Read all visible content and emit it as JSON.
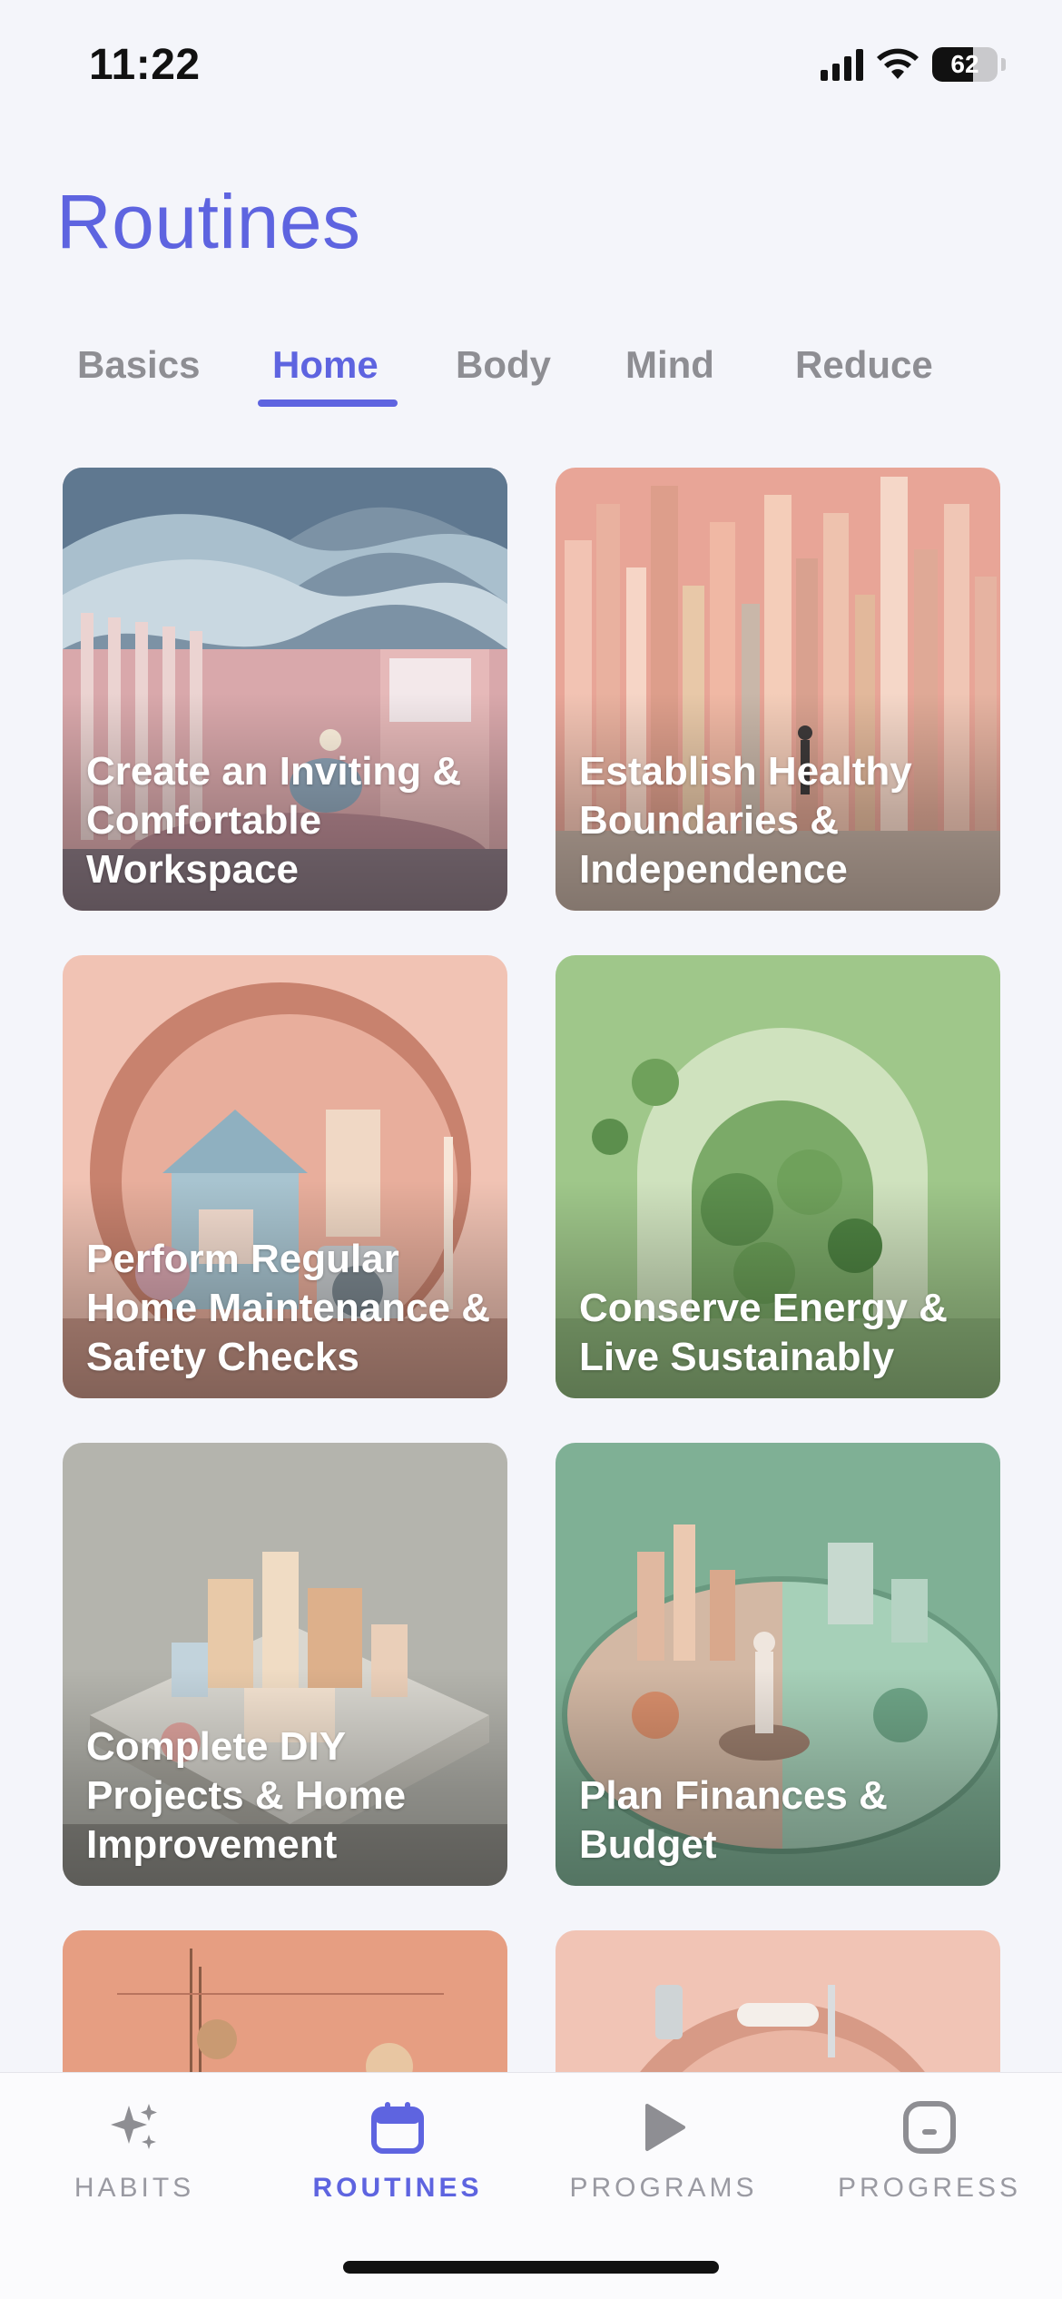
{
  "status_bar": {
    "time": "11:22",
    "battery": "62",
    "battery_level": 0.62
  },
  "page": {
    "title": "Routines"
  },
  "tabs": [
    {
      "label": "Basics",
      "active": false
    },
    {
      "label": "Home",
      "active": true
    },
    {
      "label": "Body",
      "active": false
    },
    {
      "label": "Mind",
      "active": false
    },
    {
      "label": "Reduce",
      "active": false
    }
  ],
  "routines": [
    {
      "title": "Create an Inviting & Comfortable Workspace",
      "image": "pastel-room-wave-ceiling",
      "colors": [
        "#7F93A6",
        "#D9AEB0",
        "#E8C4C2"
      ]
    },
    {
      "title": "Establish Healthy Boundaries & Independence",
      "image": "pastel-vertical-pillars-figure",
      "colors": [
        "#E5A89A",
        "#F2D2C3",
        "#C7B6A6"
      ]
    },
    {
      "title": "Perform Regular Home Maintenance & Safety Checks",
      "image": "house-tools-circle",
      "colors": [
        "#F0BFB0",
        "#C98572",
        "#9EB6C1"
      ]
    },
    {
      "title": "Conserve Energy & Live Sustainably",
      "image": "green-arch-plants",
      "colors": [
        "#A8CC8C",
        "#7FAF68",
        "#DDE9C9"
      ]
    },
    {
      "title": "Complete DIY Projects & Home Improvement",
      "image": "isometric-house-build",
      "colors": [
        "#B9B9B2",
        "#E2C7A8",
        "#8C8C86"
      ]
    },
    {
      "title": "Plan Finances & Budget",
      "image": "mint-plate-city-figure",
      "colors": [
        "#7DAF93",
        "#C7AE9A",
        "#A9D1BA"
      ]
    },
    {
      "title": "",
      "image": "peach-mobile-hanging",
      "colors": [
        "#E39B7F",
        "#F2C2A8",
        "#D38C72"
      ]
    },
    {
      "title": "",
      "image": "peach-tools-circle",
      "colors": [
        "#EFC1B2",
        "#F7D8CB",
        "#D9A08E"
      ]
    }
  ],
  "bottom_nav": [
    {
      "label": "HABITS",
      "icon": "sparkles-icon",
      "active": false
    },
    {
      "label": "ROUTINES",
      "icon": "calendar-icon",
      "active": true
    },
    {
      "label": "PROGRAMS",
      "icon": "play-icon",
      "active": false
    },
    {
      "label": "PROGRESS",
      "icon": "progress-box-icon",
      "active": false
    }
  ],
  "colors": {
    "accent": "#5E64E0",
    "inactive": "#8E8E93",
    "background": "#F4F5FA"
  }
}
